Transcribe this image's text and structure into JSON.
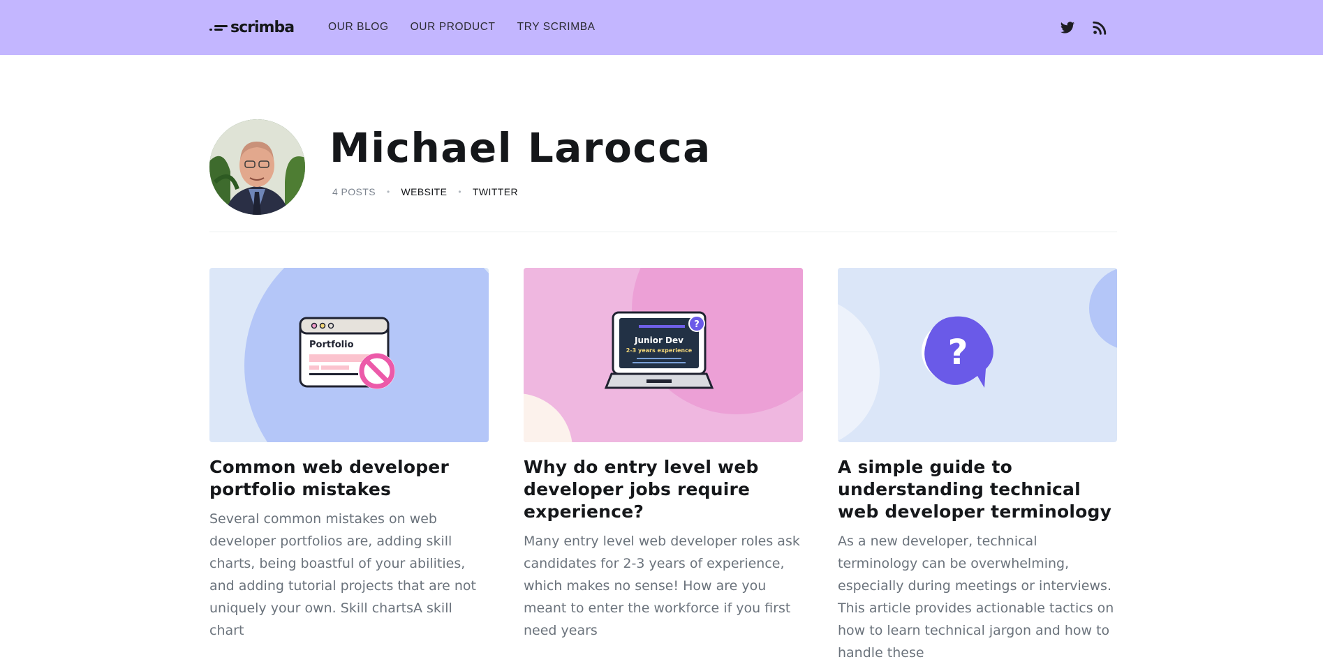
{
  "brand": {
    "logo_text": "scrimba",
    "nav_bg": "#c3b6ff"
  },
  "nav": {
    "items": [
      "OUR BLOG",
      "OUR PRODUCT",
      "TRY SCRIMBA"
    ]
  },
  "social": {
    "icons": [
      "twitter-icon",
      "rss-icon"
    ]
  },
  "author": {
    "name": "Michael Larocca",
    "posts": "4 POSTS",
    "website_label": "WEBSITE",
    "twitter_label": "TWITTER",
    "separator": "•"
  },
  "posts": [
    {
      "title": "Common web developer portfolio mistakes",
      "excerpt": "Several common mistakes on web developer portfolios are, adding skill charts, being boastful of your abilities, and adding tutorial projects that are not uniquely your own. Skill chartsA skill chart",
      "image": {
        "window_label": "Portfolio",
        "bg": "#b4c6f8"
      }
    },
    {
      "title": "Why do entry level web developer jobs require experience?",
      "excerpt": "Many entry level web developer roles ask candidates for 2-3 years of experience, which makes no sense! How are you meant to enter the workforce if you first need years",
      "image": {
        "screen_title": "Junior Dev",
        "screen_subtitle": "2-3 years experience",
        "badge": "?",
        "bg": "#efb7e0"
      }
    },
    {
      "title": "A simple guide to understanding technical web developer terminology",
      "excerpt": "As a new developer, technical terminology can be overwhelming, especially during meetings or interviews. This article provides actionable tactics on how to learn technical jargon and how to handle these",
      "image": {
        "badge": "?",
        "bg": "#dbe6f8"
      }
    }
  ]
}
